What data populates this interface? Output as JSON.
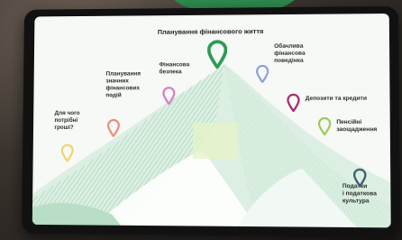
{
  "title": "Планування фінансового життя",
  "labels": {
    "why_money": "Для чого\nпотрібні\nгроші?",
    "planning_events": "Планування\nзначних\nфінансових\nподій",
    "security": "Фінансова\nбезпека",
    "careful_behavior": "Обачлива\nфінансова\nповедінка",
    "deposits": "Депозити та кредити",
    "pension": "Пенсійні\nзаощадження",
    "taxes": "Податки\nі податкова\nкультура"
  },
  "colors": {
    "why_money": "#f2d36b",
    "planning_events": "#ef8a7a",
    "security": "#d67bc6",
    "top": "#2e9a55",
    "careful_behavior": "#8fa0d8",
    "deposits": "#a42a6e",
    "pension": "#9ccc5a",
    "taxes": "#3a5a6e"
  }
}
